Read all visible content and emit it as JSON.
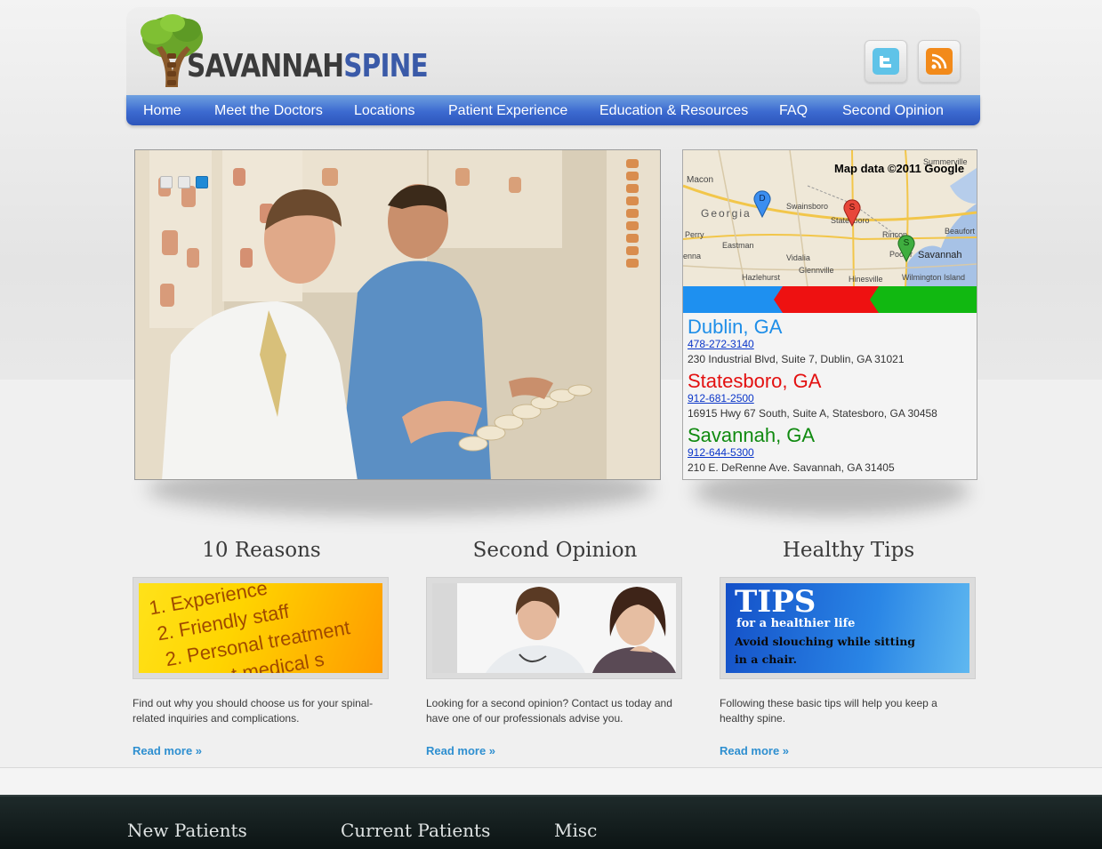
{
  "brand": {
    "name_part1": "SAVANNAH",
    "name_part2": "SPINE",
    "colors": {
      "dark": "#3b3b3b",
      "blue": "#3a5aa8",
      "nav": "#3c6ad0",
      "link": "#2e8fd0"
    }
  },
  "social": [
    {
      "icon": "twitter-icon",
      "color": "#5fc3e8"
    },
    {
      "icon": "rss-icon",
      "color": "#f28a1a"
    }
  ],
  "nav": [
    {
      "label": "Home"
    },
    {
      "label": "Meet the Doctors"
    },
    {
      "label": "Locations"
    },
    {
      "label": "Patient Experience"
    },
    {
      "label": "Education & Resources"
    },
    {
      "label": "FAQ"
    },
    {
      "label": "Second Opinion"
    }
  ],
  "slider": {
    "slide_count": 3,
    "active_index": 3
  },
  "map": {
    "credit": "Map data ©2011 Google",
    "labels": [
      "Macon",
      "Georgia",
      "Swainsboro",
      "Statesboro",
      "Perry",
      "Eastman",
      "Vidalia",
      "Glennville",
      "Hazlehurst",
      "Hinesville",
      "Pooler",
      "Savannah",
      "Wilmington Island",
      "Summerville",
      "Beaufort",
      "Rincon",
      "enna"
    ],
    "markers": [
      {
        "letter": "D",
        "color": "#3b8ef0"
      },
      {
        "letter": "S",
        "color": "#e8473a"
      },
      {
        "letter": "S",
        "color": "#3fae3f"
      }
    ],
    "band_colors": [
      "#1e90f0",
      "#ee1111",
      "#11b811"
    ]
  },
  "locations": [
    {
      "name": "Dublin, GA",
      "color": "#1e8ee8",
      "phone": "478-272-3140",
      "address": "230 Industrial Blvd, Suite 7, Dublin, GA 31021"
    },
    {
      "name": "Statesboro, GA",
      "color": "#e31010",
      "phone": "912-681-2500",
      "address": "16915 Hwy 67 South, Suite A, Statesboro, GA 30458"
    },
    {
      "name": "Savannah, GA",
      "color": "#108a10",
      "phone": "912-644-5300",
      "address": "210 E. DeRenne Ave. Savannah, GA 31405"
    }
  ],
  "features": [
    {
      "title": "10 Reasons",
      "image_lines": [
        "1. Experience",
        "2. Friendly staff",
        "2. Personal treatment",
        "...t medical s"
      ],
      "description": "Find out why you should choose us for your spinal-related inquiries and complications.",
      "link": "Read more »"
    },
    {
      "title": "Second Opinion",
      "description": "Looking for a second opinion? Contact us today and have one of our professionals advise you.",
      "link": "Read more »"
    },
    {
      "title": "Healthy Tips",
      "image_lines": [
        "TIPS",
        "for a healthier life",
        "Avoid slouching while sitting",
        "in a chair."
      ],
      "description": "Following these basic tips will help you keep a healthy spine.",
      "link": "Read more »"
    }
  ],
  "footer": {
    "columns": [
      "New Patients",
      "Current Patients",
      "Misc"
    ]
  }
}
